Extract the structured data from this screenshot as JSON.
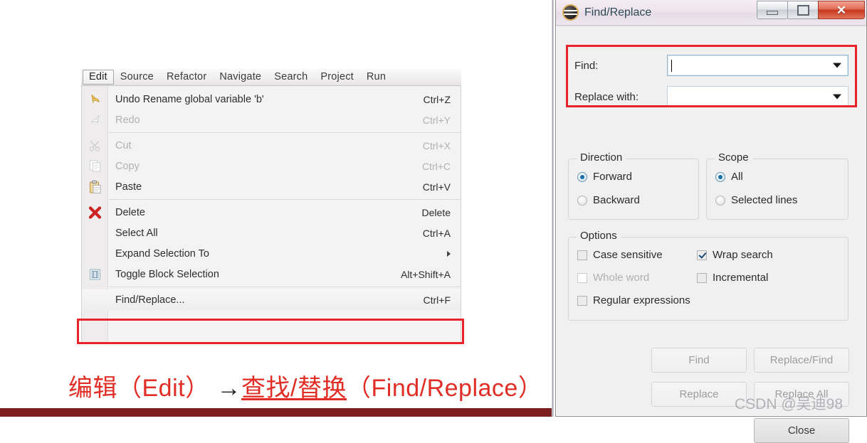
{
  "menubar": {
    "items": [
      {
        "label": "Edit",
        "active": true
      },
      {
        "label": "Source",
        "active": false
      },
      {
        "label": "Refactor",
        "active": false
      },
      {
        "label": "Navigate",
        "active": false
      },
      {
        "label": "Search",
        "active": false
      },
      {
        "label": "Project",
        "active": false
      },
      {
        "label": "Run",
        "active": false
      }
    ]
  },
  "edit_menu": {
    "items": [
      {
        "label": "Undo Rename global variable 'b'",
        "accel": "Ctrl+Z",
        "icon": "undo-arrow-icon",
        "disabled": false
      },
      {
        "label": "Redo",
        "accel": "Ctrl+Y",
        "icon": "redo-arrow-icon",
        "disabled": true
      },
      {
        "separator_after": true
      },
      {
        "label": "Cut",
        "accel": "Ctrl+X",
        "icon": "scissors-icon",
        "disabled": true
      },
      {
        "label": "Copy",
        "accel": "Ctrl+C",
        "icon": "copy-pages-icon",
        "disabled": true
      },
      {
        "label": "Paste",
        "accel": "Ctrl+V",
        "icon": "clipboard-icon",
        "disabled": false
      },
      {
        "separator_after": true
      },
      {
        "label": "Delete",
        "accel": "Delete",
        "icon": "red-x-icon",
        "disabled": false
      },
      {
        "label": "Select All",
        "accel": "Ctrl+A",
        "icon": "",
        "disabled": false
      },
      {
        "label": "Expand Selection To",
        "accel": "",
        "icon": "",
        "submenu": true,
        "disabled": false
      },
      {
        "label": "Toggle Block Selection",
        "accel": "Alt+Shift+A",
        "icon": "block-selection-icon",
        "disabled": false
      },
      {
        "separator_after": true
      },
      {
        "label": "Find/Replace...",
        "accel": "Ctrl+F",
        "icon": "",
        "disabled": false,
        "highlighted": true
      }
    ]
  },
  "caption": {
    "part1": "编辑（Edit）",
    "arrow": "→",
    "part2": "查找/替换",
    "part3": "（Find/Replace）"
  },
  "dialog": {
    "title": "Find/Replace",
    "icon": "eclipse-icon",
    "window_buttons": {
      "minimize": "—",
      "maximize": "❐",
      "close": "✕"
    },
    "find": {
      "label": "Find:",
      "value": "",
      "placeholder": ""
    },
    "replace": {
      "label": "Replace with:",
      "value": "",
      "placeholder": ""
    },
    "direction": {
      "title": "Direction",
      "options": [
        {
          "label": "Forward",
          "selected": true
        },
        {
          "label": "Backward",
          "selected": false
        }
      ]
    },
    "scope": {
      "title": "Scope",
      "options": [
        {
          "label": "All",
          "selected": true
        },
        {
          "label": "Selected lines",
          "selected": false
        }
      ]
    },
    "options": {
      "title": "Options",
      "items": [
        {
          "label": "Case sensitive",
          "checked": false,
          "enabled": true
        },
        {
          "label": "Wrap search",
          "checked": true,
          "enabled": true
        },
        {
          "label": "Whole word",
          "checked": false,
          "enabled": false
        },
        {
          "label": "Incremental",
          "checked": false,
          "enabled": true
        },
        {
          "label": "Regular expressions",
          "checked": false,
          "enabled": true
        }
      ]
    },
    "buttons": {
      "find": "Find",
      "replace_find": "Replace/Find",
      "replace": "Replace",
      "replace_all": "Replace All",
      "close": "Close"
    }
  },
  "watermark": "CSDN @吴迪98",
  "colors": {
    "highlight_red": "#e8232a",
    "caption_red": "#e02e26",
    "dialog_bg": "#f0f0f0",
    "radio_blue": "#1b6fa8"
  }
}
